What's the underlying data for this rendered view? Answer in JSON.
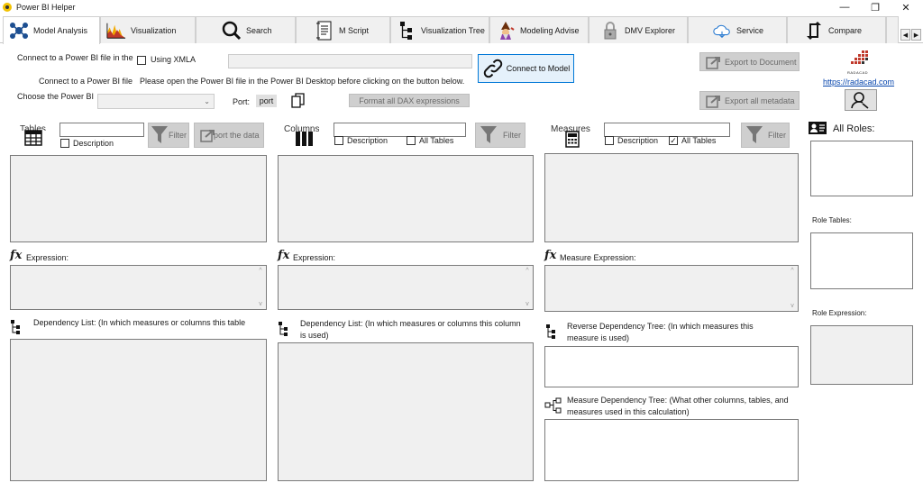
{
  "app": {
    "title": "Power BI Helper"
  },
  "window": {
    "minimize": "—",
    "restore": "❐",
    "close": "✕"
  },
  "tabs": [
    {
      "label": "Model Analysis",
      "icon": "model-analysis-icon",
      "active": true
    },
    {
      "label": "Visualization",
      "icon": "visualization-icon"
    },
    {
      "label": "Search",
      "icon": "search-icon"
    },
    {
      "label": "M Script",
      "icon": "m-script-icon"
    },
    {
      "label": "Visualization Tree",
      "icon": "tree-icon"
    },
    {
      "label": "Modeling Advise",
      "icon": "wizard-icon"
    },
    {
      "label": "DMV Explorer",
      "icon": "lock-icon"
    },
    {
      "label": "Service",
      "icon": "cloud-icon"
    },
    {
      "label": "Compare",
      "icon": "compare-icon"
    }
  ],
  "connect": {
    "file_label": "Connect to a Power BI file in the",
    "xmla_label": "Using XMLA",
    "file_label2": "Connect to a Power BI file",
    "instructions": "Please open the Power BI file in the Power BI Desktop before clicking on the button below.",
    "choose_label": "Choose the Power BI",
    "port_label": "Port:",
    "port_value": "port",
    "connect_button": "Connect to Model",
    "format_button": "Format all DAX expressions",
    "export_doc_button": "Export to Document",
    "export_meta_button": "Export all metadata",
    "link": "https://radacad.com",
    "logo_text": "RADACAD"
  },
  "tables": {
    "heading": "Tables",
    "description": "Description",
    "filter": "Filter",
    "export": "Export the data",
    "export_visible": "port the data"
  },
  "columns": {
    "heading": "Columns",
    "description": "Description",
    "all_tables": "All Tables",
    "filter": "Filter"
  },
  "measures": {
    "heading": "Measures",
    "description": "Description",
    "all_tables": "All Tables",
    "filter": "Filter"
  },
  "expressions": {
    "table": "Expression:",
    "column": "Expression:",
    "measure": "Measure Expression:"
  },
  "dependency": {
    "table": "Dependency List: (In which measures or columns this table",
    "column": "Dependency List: (In which measures or columns this column is used)",
    "reverse": "Reverse Dependency Tree: (In which measures this measure is used)",
    "measure_tree": "Measure Dependency Tree: (What other columns, tables, and measures used in this calculation)"
  },
  "roles": {
    "heading": "All Roles:",
    "tables": "Role Tables:",
    "expression": "Role Expression:"
  }
}
